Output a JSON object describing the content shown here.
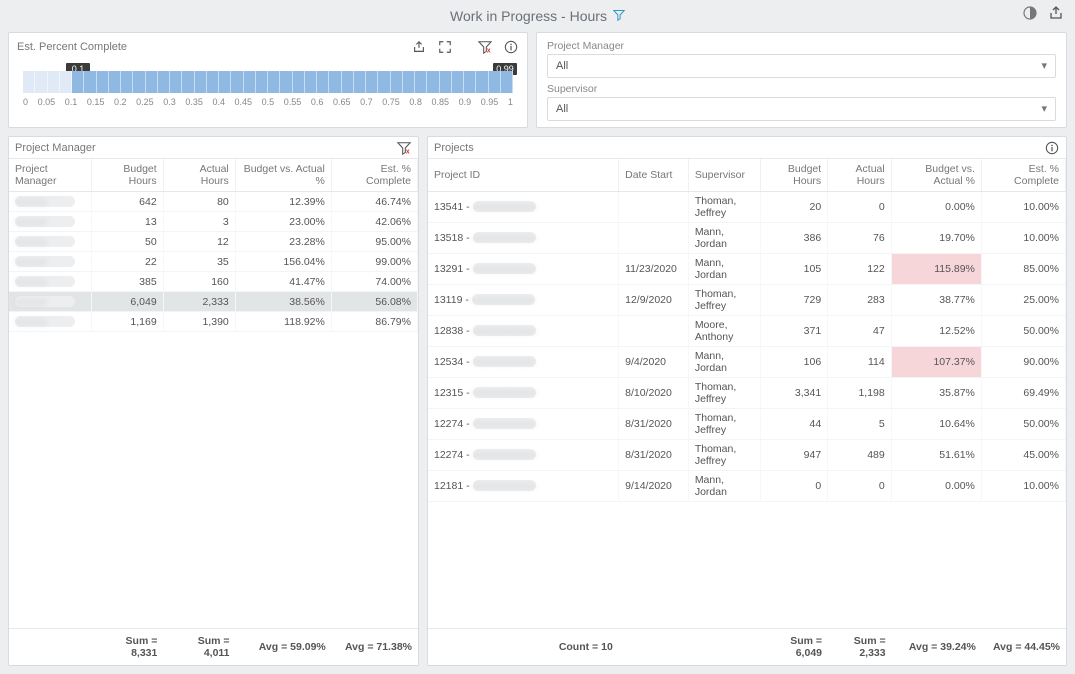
{
  "header": {
    "title": "Work in Progress - Hours"
  },
  "slider": {
    "label": "Est. Percent Complete",
    "low_label": "0.1",
    "high_label": "0.99",
    "ticks": [
      "0",
      "0.05",
      "0.1",
      "0.15",
      "0.2",
      "0.25",
      "0.3",
      "0.35",
      "0.4",
      "0.45",
      "0.5",
      "0.55",
      "0.6",
      "0.65",
      "0.7",
      "0.75",
      "0.8",
      "0.85",
      "0.9",
      "0.95",
      "1"
    ]
  },
  "filters": {
    "pm_label": "Project Manager",
    "pm_value": "All",
    "sup_label": "Supervisor",
    "sup_value": "All"
  },
  "left_panel": {
    "title": "Project Manager",
    "columns": [
      "Project Manager",
      "Budget Hours",
      "Actual Hours",
      "Budget vs. Actual %",
      "Est. % Complete"
    ],
    "rows": [
      {
        "_sel": false,
        "cells": [
          "",
          "642",
          "80",
          "12.39%",
          "46.74%"
        ]
      },
      {
        "_sel": false,
        "cells": [
          "",
          "13",
          "3",
          "23.00%",
          "42.06%"
        ]
      },
      {
        "_sel": false,
        "cells": [
          "",
          "50",
          "12",
          "23.28%",
          "95.00%"
        ]
      },
      {
        "_sel": false,
        "cells": [
          "",
          "22",
          "35",
          "156.04%",
          "99.00%"
        ]
      },
      {
        "_sel": false,
        "cells": [
          "",
          "385",
          "160",
          "41.47%",
          "74.00%"
        ]
      },
      {
        "_sel": true,
        "cells": [
          "",
          "6,049",
          "2,333",
          "38.56%",
          "56.08%"
        ]
      },
      {
        "_sel": false,
        "cells": [
          "",
          "1,169",
          "1,390",
          "118.92%",
          "86.79%"
        ]
      }
    ],
    "footer": [
      "",
      "Sum = 8,331",
      "Sum = 4,011",
      "Avg = 59.09%",
      "Avg = 71.38%"
    ]
  },
  "right_panel": {
    "title": "Projects",
    "columns": [
      "Project ID",
      "Date Start",
      "Supervisor",
      "Budget Hours",
      "Actual Hours",
      "Budget vs. Actual %",
      "Est. % Complete"
    ],
    "rows": [
      {
        "id": "13541",
        "date": "",
        "sup": "Thoman, Jeffrey",
        "bh": "20",
        "ah": "0",
        "bva": "0.00%",
        "ec": "10.00%"
      },
      {
        "id": "13518",
        "date": "",
        "sup": "Mann, Jordan",
        "bh": "386",
        "ah": "76",
        "bva": "19.70%",
        "ec": "10.00%"
      },
      {
        "id": "13291",
        "date": "11/23/2020",
        "sup": "Mann, Jordan",
        "bh": "105",
        "ah": "122",
        "bva": "115.89%",
        "ec": "85.00%",
        "bva_red": true
      },
      {
        "id": "13119",
        "date": "12/9/2020",
        "sup": "Thoman, Jeffrey",
        "bh": "729",
        "ah": "283",
        "bva": "38.77%",
        "ec": "25.00%"
      },
      {
        "id": "12838",
        "date": "",
        "sup": "Moore, Anthony",
        "bh": "371",
        "ah": "47",
        "bva": "12.52%",
        "ec": "50.00%"
      },
      {
        "id": "12534",
        "date": "9/4/2020",
        "sup": "Mann, Jordan",
        "bh": "106",
        "ah": "114",
        "bva": "107.37%",
        "ec": "90.00%",
        "bva_red": true
      },
      {
        "id": "12315",
        "date": "8/10/2020",
        "sup": "Thoman, Jeffrey",
        "bh": "3,341",
        "ah": "1,198",
        "bva": "35.87%",
        "ec": "69.49%"
      },
      {
        "id": "12274",
        "date": "8/31/2020",
        "sup": "Thoman, Jeffrey",
        "bh": "44",
        "ah": "5",
        "bva": "10.64%",
        "ec": "50.00%"
      },
      {
        "id": "12274",
        "date": "8/31/2020",
        "sup": "Thoman, Jeffrey",
        "bh": "947",
        "ah": "489",
        "bva": "51.61%",
        "ec": "45.00%"
      },
      {
        "id": "12181",
        "date": "9/14/2020",
        "sup": "Mann, Jordan",
        "bh": "0",
        "ah": "0",
        "bva": "0.00%",
        "ec": "10.00%"
      }
    ],
    "footer": {
      "count": "Count = 10",
      "sum_bh": "Sum = 6,049",
      "sum_ah": "Sum = 2,333",
      "avg_bva": "Avg = 39.24%",
      "avg_ec": "Avg = 44.45%"
    }
  }
}
